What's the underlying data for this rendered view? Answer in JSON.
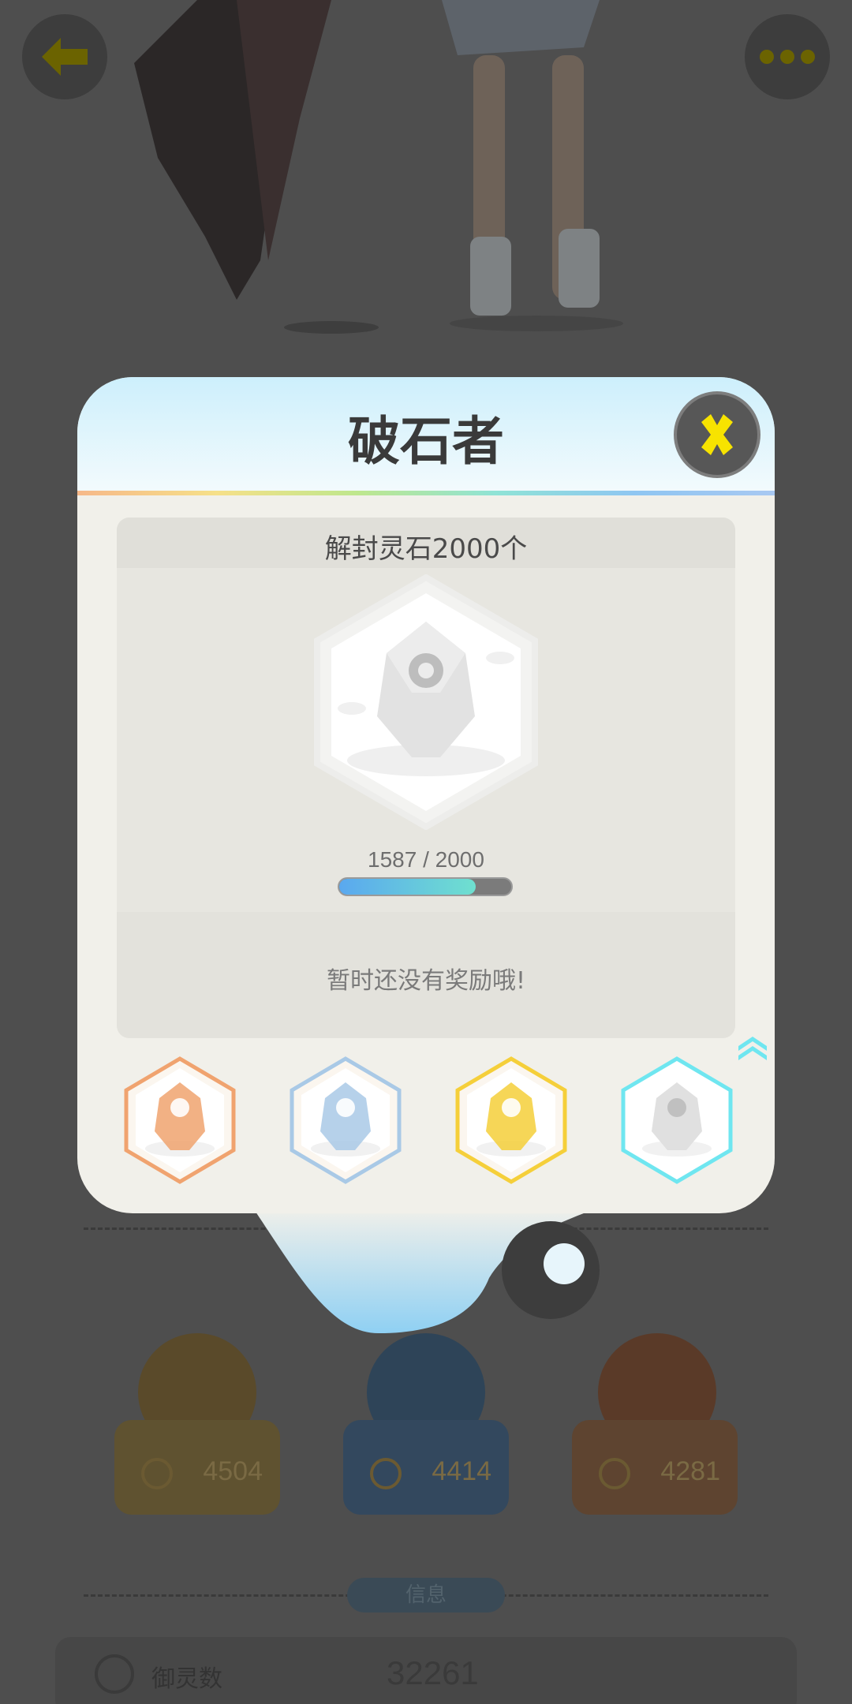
{
  "modal": {
    "title": "破石者",
    "task_text": "解封灵石2000个",
    "progress_text": "1587 / 2000",
    "progress_value": 1587,
    "progress_max": 2000,
    "reward_text": "暂时还没有奖励哦!"
  },
  "tiers": [
    {
      "name": "bronze",
      "color": "#f0a36f"
    },
    {
      "name": "silver",
      "color": "#a9c9e6"
    },
    {
      "name": "gold",
      "color": "#f5cf3a"
    },
    {
      "name": "diamond",
      "color": "#6fe6f0"
    }
  ],
  "background": {
    "heroes": [
      {
        "value": "4504",
        "color": "#5f5230"
      },
      {
        "value": "4414",
        "color": "#33485e"
      },
      {
        "value": "4281",
        "color": "#5e4430"
      }
    ],
    "info_label": "信息",
    "stat_label": "御灵数",
    "stat_value": "32261"
  },
  "colors": {
    "accent_yellow": "#f7e300",
    "progress_fill_start": "#5aa8ef",
    "progress_fill_end": "#6fe0cf"
  },
  "icons": {
    "back": "back-arrow-icon",
    "more": "more-dots-icon",
    "close": "close-x-icon"
  }
}
